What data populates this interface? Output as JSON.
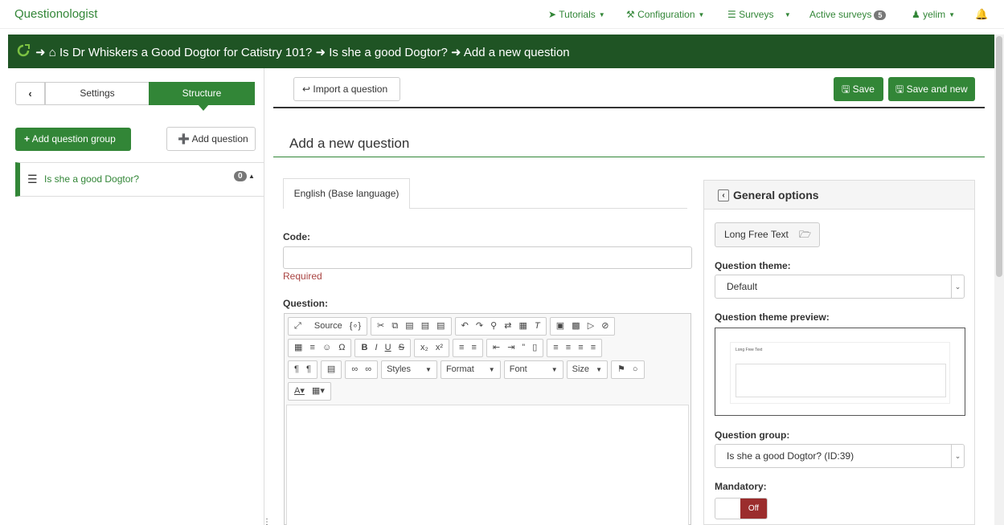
{
  "app": {
    "brand": "Questionologist"
  },
  "topnav": {
    "tutorials": "Tutorials",
    "configuration": "Configuration",
    "surveys": "Surveys",
    "active_surveys": "Active surveys",
    "active_surveys_count": "5",
    "user": "yelim"
  },
  "breadcrumb": {
    "survey": "Is Dr Whiskers a Good Dogtor for Catistry 101?",
    "group": "Is she a good Dogtor?",
    "page": "Add a new question"
  },
  "sidebar": {
    "tab_settings": "Settings",
    "tab_structure": "Structure",
    "add_group": "Add question group",
    "add_question": "Add question",
    "groups": [
      {
        "name": "Is she a good Dogtor?",
        "count": "0"
      }
    ]
  },
  "toolbar": {
    "import": "Import a question",
    "save": "Save",
    "save_new": "Save and new"
  },
  "main": {
    "title": "Add a new question",
    "lang_tab": "English (Base language)",
    "code_label": "Code:",
    "code_value": "",
    "required": "Required",
    "question_label": "Question:"
  },
  "editor": {
    "source": "Source",
    "styles": "Styles",
    "format": "Format",
    "font": "Font",
    "size": "Size"
  },
  "general": {
    "title": "General options",
    "question_type": "Long Free Text",
    "theme_label": "Question theme:",
    "theme_value": "Default",
    "preview_label": "Question theme preview:",
    "preview_text": "Long Free Text",
    "group_label": "Question group:",
    "group_value": "Is she a good Dogtor? (ID:39)",
    "mandatory_label": "Mandatory:",
    "mandatory_value": "Off"
  },
  "colors": {
    "brand_green": "#328637",
    "dark_green": "#1f5424",
    "off_red": "#9b2d2d"
  }
}
